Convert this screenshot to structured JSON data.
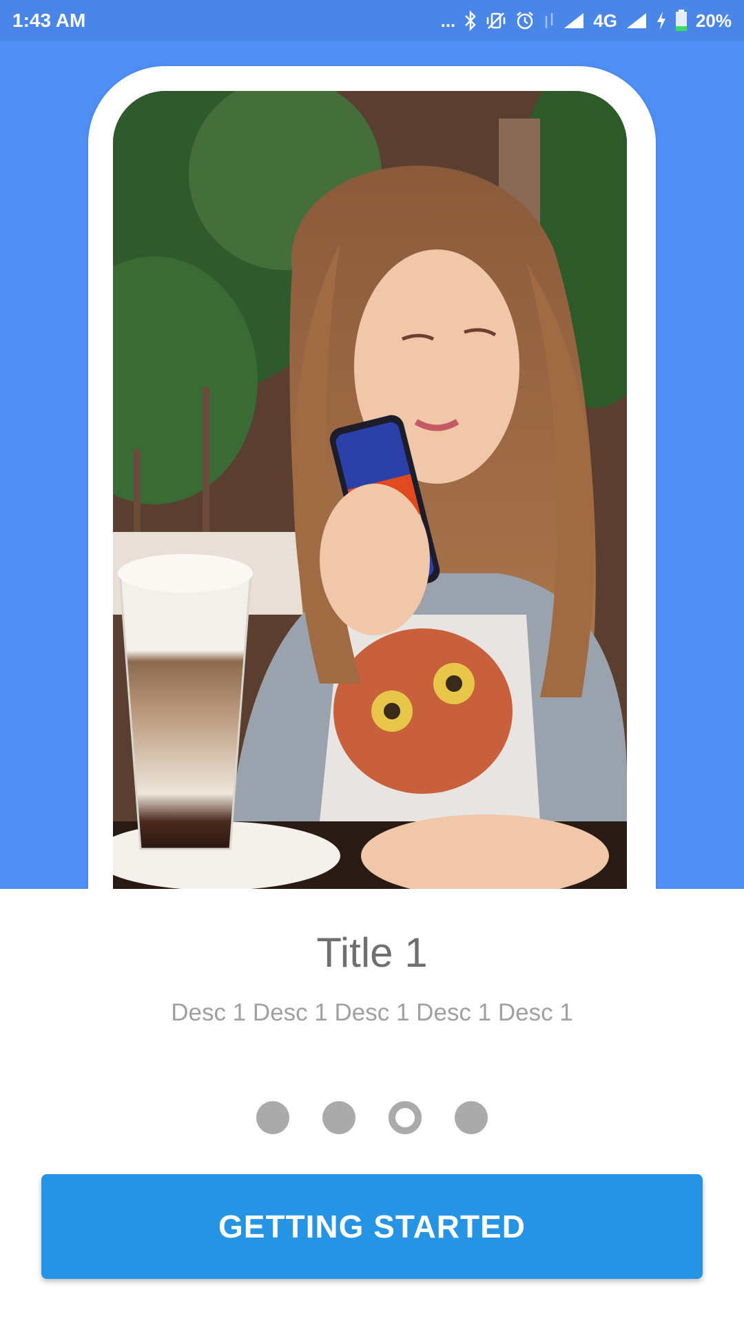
{
  "status_bar": {
    "time": "1:43 AM",
    "dots": "...",
    "network": "4G",
    "battery": "20%",
    "icons": [
      "bluetooth-icon",
      "vibrate-off-icon",
      "alarm-icon",
      "data-arrows-icon",
      "signal-icon",
      "signal-icon",
      "charging-icon",
      "battery-icon"
    ]
  },
  "hero": {
    "background_color": "#4f8ff5",
    "image": "photo of woman looking at phone with a latte"
  },
  "onboarding": {
    "title": "Title 1",
    "description": "Desc 1 Desc 1 Desc 1 Desc 1 Desc 1",
    "page_count": 4,
    "active_page": 3
  },
  "cta": {
    "label": "GETTING STARTED",
    "color": "#2594e4"
  }
}
